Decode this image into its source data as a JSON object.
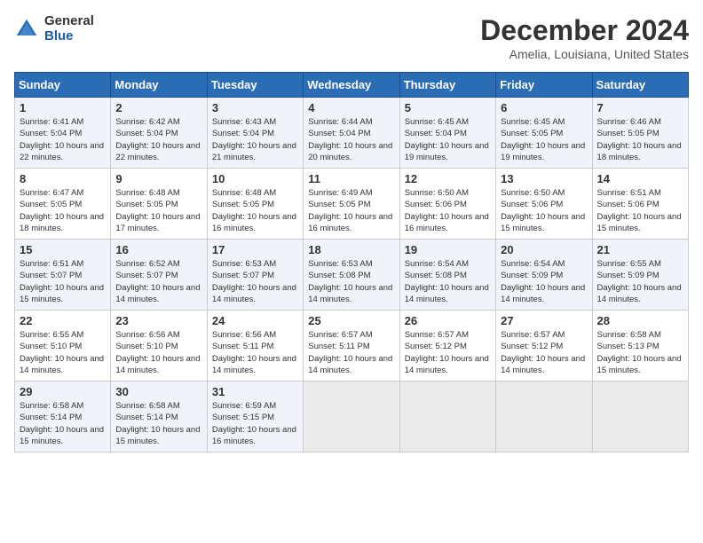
{
  "header": {
    "logo_general": "General",
    "logo_blue": "Blue",
    "month_title": "December 2024",
    "location": "Amelia, Louisiana, United States"
  },
  "weekdays": [
    "Sunday",
    "Monday",
    "Tuesday",
    "Wednesday",
    "Thursday",
    "Friday",
    "Saturday"
  ],
  "weeks": [
    [
      {
        "day": "1",
        "sunrise": "Sunrise: 6:41 AM",
        "sunset": "Sunset: 5:04 PM",
        "daylight": "Daylight: 10 hours and 22 minutes."
      },
      {
        "day": "2",
        "sunrise": "Sunrise: 6:42 AM",
        "sunset": "Sunset: 5:04 PM",
        "daylight": "Daylight: 10 hours and 22 minutes."
      },
      {
        "day": "3",
        "sunrise": "Sunrise: 6:43 AM",
        "sunset": "Sunset: 5:04 PM",
        "daylight": "Daylight: 10 hours and 21 minutes."
      },
      {
        "day": "4",
        "sunrise": "Sunrise: 6:44 AM",
        "sunset": "Sunset: 5:04 PM",
        "daylight": "Daylight: 10 hours and 20 minutes."
      },
      {
        "day": "5",
        "sunrise": "Sunrise: 6:45 AM",
        "sunset": "Sunset: 5:04 PM",
        "daylight": "Daylight: 10 hours and 19 minutes."
      },
      {
        "day": "6",
        "sunrise": "Sunrise: 6:45 AM",
        "sunset": "Sunset: 5:05 PM",
        "daylight": "Daylight: 10 hours and 19 minutes."
      },
      {
        "day": "7",
        "sunrise": "Sunrise: 6:46 AM",
        "sunset": "Sunset: 5:05 PM",
        "daylight": "Daylight: 10 hours and 18 minutes."
      }
    ],
    [
      {
        "day": "8",
        "sunrise": "Sunrise: 6:47 AM",
        "sunset": "Sunset: 5:05 PM",
        "daylight": "Daylight: 10 hours and 18 minutes."
      },
      {
        "day": "9",
        "sunrise": "Sunrise: 6:48 AM",
        "sunset": "Sunset: 5:05 PM",
        "daylight": "Daylight: 10 hours and 17 minutes."
      },
      {
        "day": "10",
        "sunrise": "Sunrise: 6:48 AM",
        "sunset": "Sunset: 5:05 PM",
        "daylight": "Daylight: 10 hours and 16 minutes."
      },
      {
        "day": "11",
        "sunrise": "Sunrise: 6:49 AM",
        "sunset": "Sunset: 5:05 PM",
        "daylight": "Daylight: 10 hours and 16 minutes."
      },
      {
        "day": "12",
        "sunrise": "Sunrise: 6:50 AM",
        "sunset": "Sunset: 5:06 PM",
        "daylight": "Daylight: 10 hours and 16 minutes."
      },
      {
        "day": "13",
        "sunrise": "Sunrise: 6:50 AM",
        "sunset": "Sunset: 5:06 PM",
        "daylight": "Daylight: 10 hours and 15 minutes."
      },
      {
        "day": "14",
        "sunrise": "Sunrise: 6:51 AM",
        "sunset": "Sunset: 5:06 PM",
        "daylight": "Daylight: 10 hours and 15 minutes."
      }
    ],
    [
      {
        "day": "15",
        "sunrise": "Sunrise: 6:51 AM",
        "sunset": "Sunset: 5:07 PM",
        "daylight": "Daylight: 10 hours and 15 minutes."
      },
      {
        "day": "16",
        "sunrise": "Sunrise: 6:52 AM",
        "sunset": "Sunset: 5:07 PM",
        "daylight": "Daylight: 10 hours and 14 minutes."
      },
      {
        "day": "17",
        "sunrise": "Sunrise: 6:53 AM",
        "sunset": "Sunset: 5:07 PM",
        "daylight": "Daylight: 10 hours and 14 minutes."
      },
      {
        "day": "18",
        "sunrise": "Sunrise: 6:53 AM",
        "sunset": "Sunset: 5:08 PM",
        "daylight": "Daylight: 10 hours and 14 minutes."
      },
      {
        "day": "19",
        "sunrise": "Sunrise: 6:54 AM",
        "sunset": "Sunset: 5:08 PM",
        "daylight": "Daylight: 10 hours and 14 minutes."
      },
      {
        "day": "20",
        "sunrise": "Sunrise: 6:54 AM",
        "sunset": "Sunset: 5:09 PM",
        "daylight": "Daylight: 10 hours and 14 minutes."
      },
      {
        "day": "21",
        "sunrise": "Sunrise: 6:55 AM",
        "sunset": "Sunset: 5:09 PM",
        "daylight": "Daylight: 10 hours and 14 minutes."
      }
    ],
    [
      {
        "day": "22",
        "sunrise": "Sunrise: 6:55 AM",
        "sunset": "Sunset: 5:10 PM",
        "daylight": "Daylight: 10 hours and 14 minutes."
      },
      {
        "day": "23",
        "sunrise": "Sunrise: 6:56 AM",
        "sunset": "Sunset: 5:10 PM",
        "daylight": "Daylight: 10 hours and 14 minutes."
      },
      {
        "day": "24",
        "sunrise": "Sunrise: 6:56 AM",
        "sunset": "Sunset: 5:11 PM",
        "daylight": "Daylight: 10 hours and 14 minutes."
      },
      {
        "day": "25",
        "sunrise": "Sunrise: 6:57 AM",
        "sunset": "Sunset: 5:11 PM",
        "daylight": "Daylight: 10 hours and 14 minutes."
      },
      {
        "day": "26",
        "sunrise": "Sunrise: 6:57 AM",
        "sunset": "Sunset: 5:12 PM",
        "daylight": "Daylight: 10 hours and 14 minutes."
      },
      {
        "day": "27",
        "sunrise": "Sunrise: 6:57 AM",
        "sunset": "Sunset: 5:12 PM",
        "daylight": "Daylight: 10 hours and 14 minutes."
      },
      {
        "day": "28",
        "sunrise": "Sunrise: 6:58 AM",
        "sunset": "Sunset: 5:13 PM",
        "daylight": "Daylight: 10 hours and 15 minutes."
      }
    ],
    [
      {
        "day": "29",
        "sunrise": "Sunrise: 6:58 AM",
        "sunset": "Sunset: 5:14 PM",
        "daylight": "Daylight: 10 hours and 15 minutes."
      },
      {
        "day": "30",
        "sunrise": "Sunrise: 6:58 AM",
        "sunset": "Sunset: 5:14 PM",
        "daylight": "Daylight: 10 hours and 15 minutes."
      },
      {
        "day": "31",
        "sunrise": "Sunrise: 6:59 AM",
        "sunset": "Sunset: 5:15 PM",
        "daylight": "Daylight: 10 hours and 16 minutes."
      },
      null,
      null,
      null,
      null
    ]
  ]
}
